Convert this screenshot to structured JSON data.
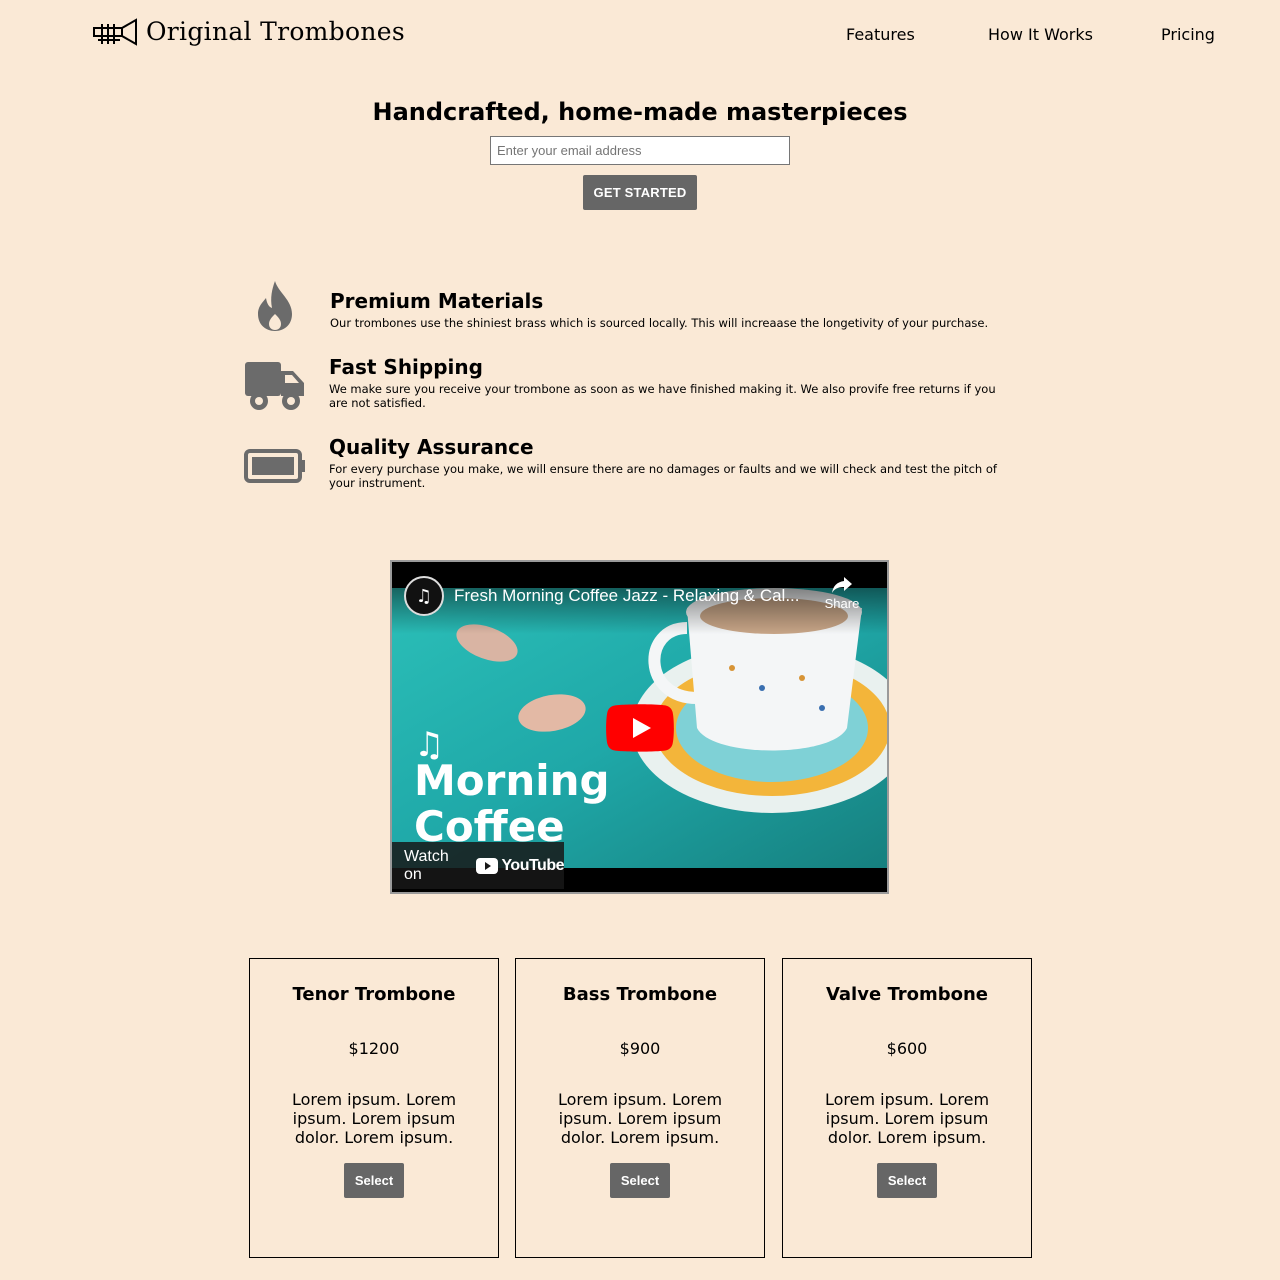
{
  "header": {
    "brand": "Original Trombones",
    "logo_icon": "trumpet-icon",
    "nav": [
      {
        "label": "Features"
      },
      {
        "label": "How It Works"
      },
      {
        "label": "Pricing"
      }
    ]
  },
  "hero": {
    "title": "Handcrafted, home-made masterpieces",
    "email_placeholder": "Enter your email address",
    "cta_label": "GET STARTED"
  },
  "features": [
    {
      "icon": "fire-icon",
      "title": "Premium Materials",
      "description": "Our trombones use the shiniest brass which is sourced locally. This will increaase the longetivity of your purchase."
    },
    {
      "icon": "truck-icon",
      "title": "Fast Shipping",
      "description": "We make sure you receive your trombone as soon as we have finished making it. We also provife free returns if you are not satisfied."
    },
    {
      "icon": "battery-icon",
      "title": "Quality Assurance",
      "description": "For every purchase you make, we will ensure there are no damages or faults and we will check and test the pitch of your instrument."
    }
  ],
  "video": {
    "title": "Fresh Morning Coffee Jazz - Relaxing & Cal...",
    "share_label": "Share",
    "watch_on_label": "Watch on",
    "youtube_label": "YouTube",
    "thumbnail_text_1": "Morning",
    "thumbnail_text_2": "Coffee",
    "colors": {
      "play": "#ff0000",
      "water": "#22b5b0"
    }
  },
  "pricing": [
    {
      "title": "Tenor Trombone",
      "price": "$1200",
      "description": "Lorem ipsum. Lorem ipsum. Lorem ipsum dolor. Lorem ipsum.",
      "button": "Select"
    },
    {
      "title": "Bass Trombone",
      "price": "$900",
      "description": "Lorem ipsum. Lorem ipsum. Lorem ipsum dolor. Lorem ipsum.",
      "button": "Select"
    },
    {
      "title": "Valve Trombone",
      "price": "$600",
      "description": "Lorem ipsum. Lorem ipsum. Lorem ipsum dolor. Lorem ipsum.",
      "button": "Select"
    }
  ],
  "colors": {
    "background": "#fae9d6",
    "button": "#666666",
    "icon": "#6b6b6b"
  }
}
